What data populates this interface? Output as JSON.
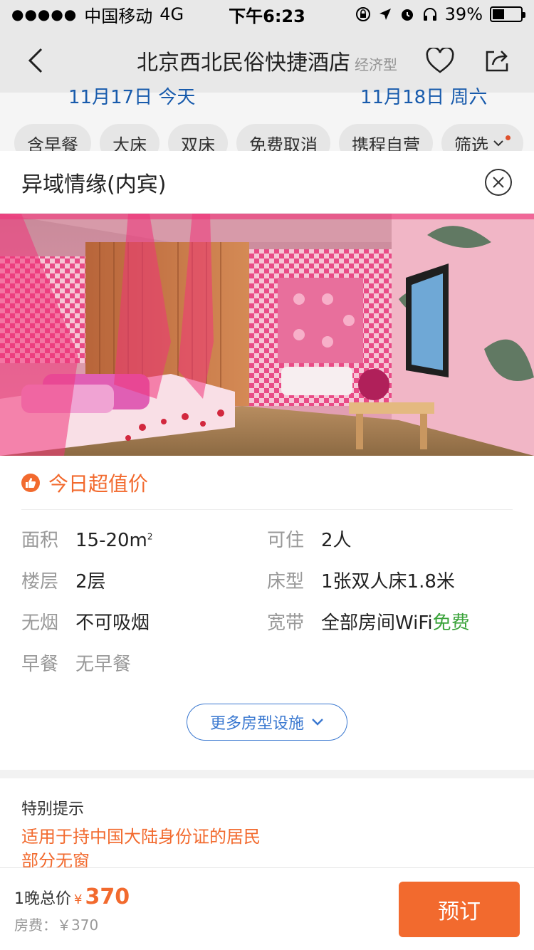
{
  "status_bar": {
    "carrier": "中国移动",
    "network": "4G",
    "time": "下午6:23",
    "battery_percent": "39%",
    "battery_level": 0.39
  },
  "nav": {
    "title": "北京西北民俗快捷酒店",
    "tag": "经济型"
  },
  "dates": {
    "checkin_partial": "11月17日 今天",
    "checkout_partial": "11月18日 周六"
  },
  "filters": [
    "含早餐",
    "大床",
    "双床",
    "免费取消",
    "携程自营",
    "筛选"
  ],
  "modal": {
    "title": "异域情缘(内宾)",
    "deal_label": "今日超值价",
    "facilities": {
      "area_label": "面积",
      "area_value": "15-20m",
      "area_unit_sup": "2",
      "occupancy_label": "可住",
      "occupancy_value": "2人",
      "floor_label": "楼层",
      "floor_value": "2层",
      "bed_label": "床型",
      "bed_value": "1张双人床1.8米",
      "smoking_label": "无烟",
      "smoking_value": "不可吸烟",
      "broadband_label": "宽带",
      "broadband_value": "全部房间WiFi",
      "broadband_free": "免费",
      "breakfast_label": "早餐",
      "breakfast_value": "无早餐"
    },
    "more_button": "更多房型设施",
    "notice_title": "特别提示",
    "notice_lines": [
      "适用于持中国大陆身份证的居民",
      "部分无窗"
    ]
  },
  "footer": {
    "total_label": "1晚总价",
    "currency": "¥",
    "total_amount": "370",
    "room_fee": "房费：￥370",
    "book_button": "预订"
  },
  "colors": {
    "accent": "#f26a2e",
    "link_blue": "#3a78d0",
    "free_green": "#3aa33a"
  }
}
